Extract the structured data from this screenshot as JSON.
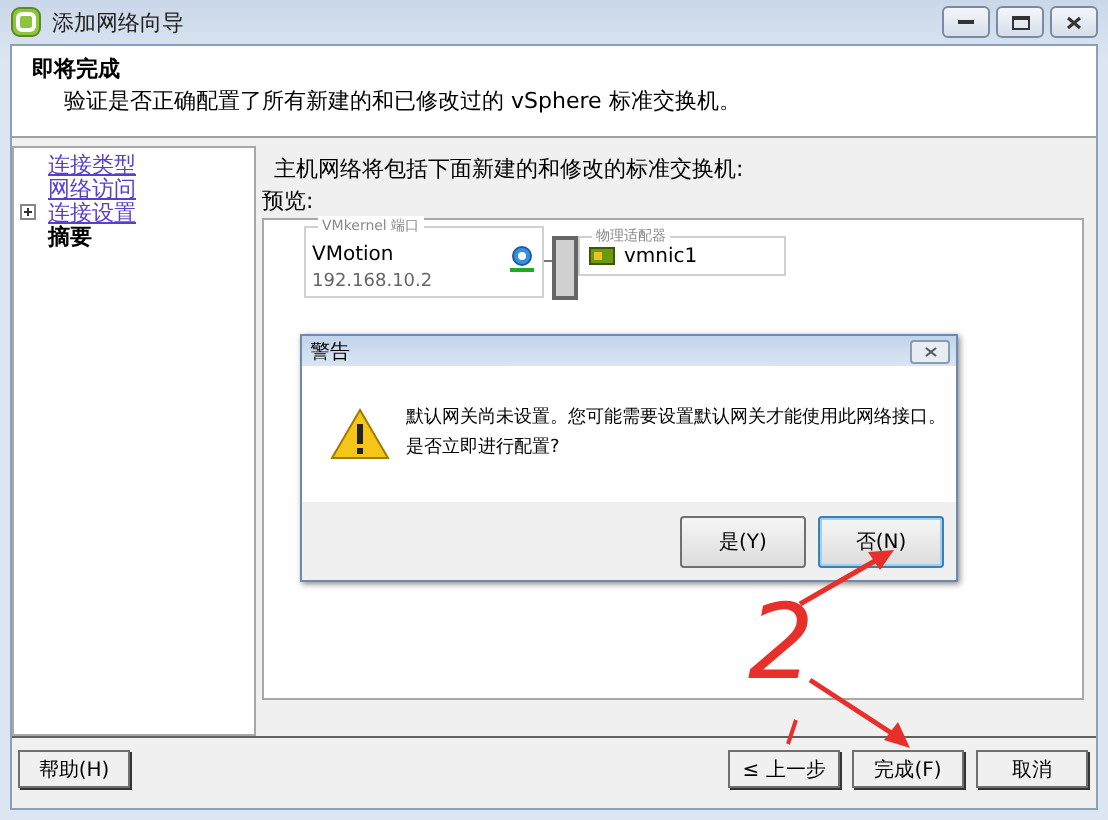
{
  "window": {
    "title": "添加网络向导"
  },
  "header": {
    "title": "即将完成",
    "subtitle": "验证是否正确配置了所有新建的和已修改过的 vSphere 标准交换机。"
  },
  "sidebar": {
    "items": [
      {
        "label": "连接类型",
        "kind": "link"
      },
      {
        "label": "网络访问",
        "kind": "link"
      },
      {
        "label": "连接设置",
        "kind": "link",
        "expandable": true
      },
      {
        "label": "摘要",
        "kind": "current"
      }
    ]
  },
  "content": {
    "intro": "主机网络将包括下面新建的和修改的标准交换机:",
    "preview_label": "预览:",
    "port_group": {
      "legend": "VMkernel 端口",
      "name": "VMotion",
      "ip": "192.168.10.2"
    },
    "adapters": {
      "legend": "物理适配器",
      "name": "vmnic1"
    }
  },
  "dialog": {
    "title": "警告",
    "message": [
      "默认网关尚未设置。您可能需要设置默认网关才能使用此网络接口。",
      "是否立即进行配置?"
    ],
    "buttons": [
      {
        "label": "是(Y)",
        "selected": false
      },
      {
        "label": "否(N)",
        "selected": true
      }
    ]
  },
  "buttons": [
    {
      "label": "帮助(H)"
    },
    {
      "label": "≤ 上一步"
    },
    {
      "label": "完成(F)"
    },
    {
      "label": "取消"
    }
  ],
  "annotation": {
    "label": "2"
  }
}
